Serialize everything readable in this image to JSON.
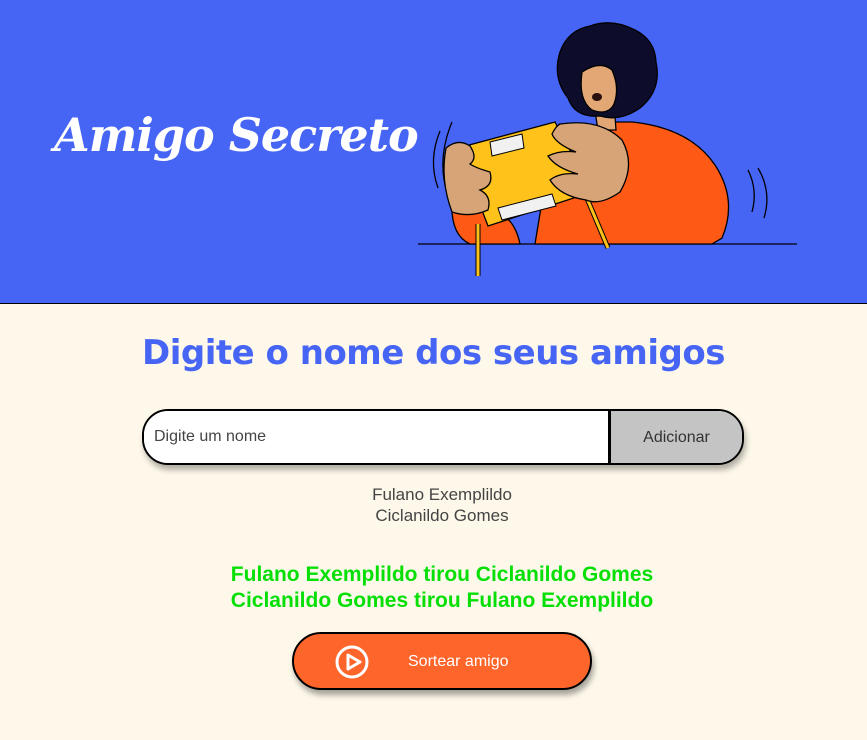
{
  "header": {
    "title": "Amigo Secreto",
    "background_color": "#4765F5",
    "illustration": "person-holding-gift-illustration"
  },
  "main": {
    "heading": "Digite o nome dos seus amigos",
    "background_color": "#FEF8EA"
  },
  "input": {
    "placeholder": "Digite um nome",
    "value": ""
  },
  "add_button": {
    "label": "Adicionar",
    "color": "#C4C4C4"
  },
  "friends": [
    "Fulano Exemplildo",
    "Ciclanildo Gomes"
  ],
  "results": [
    "Fulano Exemplildo tirou Ciclanildo Gomes",
    "Ciclanildo Gomes tirou Fulano Exemplildo"
  ],
  "result_color": "#05DF05",
  "draw_button": {
    "label": "Sortear amigo",
    "icon": "play-circle-icon",
    "color": "#FE652B"
  }
}
